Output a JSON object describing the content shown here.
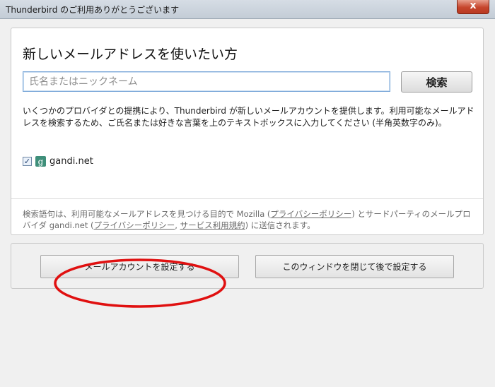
{
  "window": {
    "title": "Thunderbird のご利用ありがとうございます",
    "close_label": "x"
  },
  "main": {
    "heading": "新しいメールアドレスを使いたい方",
    "search": {
      "placeholder": "氏名またはニックネーム",
      "value": "",
      "button_label": "検索"
    },
    "description": "いくつかのプロバイダとの提携により、Thunderbird が新しいメールアカウントを提供します。利用可能なメールアドレスを検索するため、ご氏名または好きな言葉を上のテキストボックスに入力してください (半角英数字のみ)。",
    "provider": {
      "name": "gandi.net",
      "checked": true,
      "icon": "gandi-icon"
    },
    "footnote": {
      "part1": "検索語句は、利用可能なメールアドレスを見つける目的で Mozilla (",
      "link_privacy_mozilla": "プライバシーポリシー",
      "part2": ") とサードパーティのメールプロバイダ gandi.net (",
      "link_privacy_gandi": "プライバシーポリシー",
      "sep": ", ",
      "link_terms": "サービス利用規約",
      "part3": ") に送信されます。"
    }
  },
  "actions": {
    "setup_label": "メールアカウントを設定する",
    "later_label": "このウィンドウを閉じて後で設定する"
  },
  "colors": {
    "annotation": "#e01010",
    "close_button": "#c6452c"
  }
}
